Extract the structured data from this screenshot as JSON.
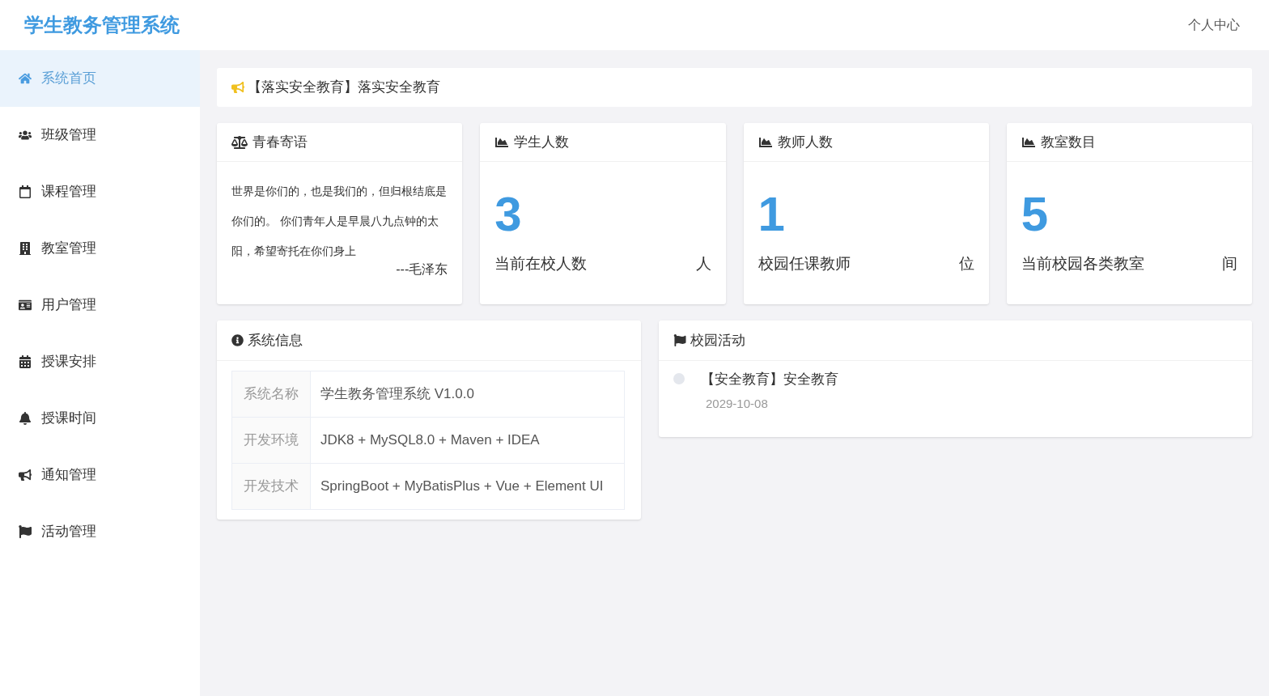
{
  "header": {
    "title": "学生教务管理系统",
    "user_menu": "个人中心"
  },
  "sidebar": {
    "items": [
      {
        "label": "系统首页",
        "selected": true
      },
      {
        "label": "班级管理",
        "selected": false
      },
      {
        "label": "课程管理",
        "selected": false
      },
      {
        "label": "教室管理",
        "selected": false
      },
      {
        "label": "用户管理",
        "selected": false
      },
      {
        "label": "授课安排",
        "selected": false
      },
      {
        "label": "授课时间",
        "selected": false
      },
      {
        "label": "通知管理",
        "selected": false
      },
      {
        "label": "活动管理",
        "selected": false
      }
    ]
  },
  "notice": "【落实安全教育】落实安全教育",
  "quote_card": {
    "title": "青春寄语",
    "text": "世界是你们的，也是我们的，但归根结底是你们的。 你们青年人是早晨八九点钟的太阳，希望寄托在你们身上",
    "author": "---毛泽东"
  },
  "stat_cards": [
    {
      "title": "学生人数",
      "value": "3",
      "label": "当前在校人数",
      "unit": "人"
    },
    {
      "title": "教师人数",
      "value": "1",
      "label": "校园任课教师",
      "unit": "位"
    },
    {
      "title": "教室数目",
      "value": "5",
      "label": "当前校园各类教室",
      "unit": "间"
    }
  ],
  "system_info": {
    "title": "系统信息",
    "rows": [
      {
        "key": "系统名称",
        "value": "学生教务管理系统 V1.0.0"
      },
      {
        "key": "开发环境",
        "value": "JDK8 + MySQL8.0 + Maven + IDEA"
      },
      {
        "key": "开发技术",
        "value": "SpringBoot + MyBatisPlus + Vue + Element UI"
      }
    ]
  },
  "activities": {
    "title": "校园活动",
    "items": [
      {
        "title": "【安全教育】安全教育",
        "date": "2029-10-08"
      }
    ]
  }
}
